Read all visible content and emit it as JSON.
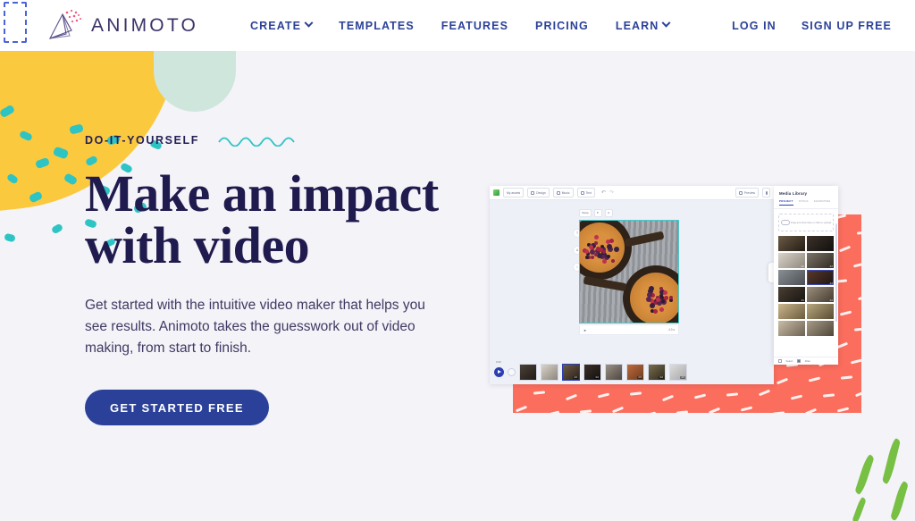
{
  "brand": {
    "name": "ANIMOTO",
    "logo_icon": "animoto-fan-logo",
    "accent_blue": "#2b4199",
    "headline_navy": "#201b4e",
    "teal": "#2ec4c4",
    "yellow": "#fbc93d",
    "coral": "#fb6d5d",
    "green": "#77c043"
  },
  "nav": {
    "items": [
      {
        "label": "CREATE",
        "has_dropdown": true
      },
      {
        "label": "TEMPLATES",
        "has_dropdown": false
      },
      {
        "label": "FEATURES",
        "has_dropdown": false
      },
      {
        "label": "PRICING",
        "has_dropdown": false
      },
      {
        "label": "LEARN",
        "has_dropdown": true
      }
    ],
    "login_label": "LOG IN",
    "signup_label": "SIGN UP FREE"
  },
  "hero": {
    "eyebrow": "DO-IT-YOURSELF",
    "headline_line1": "Make an impact",
    "headline_line2": "with video",
    "subcopy": "Get started with the intuitive video maker that helps you see results. Animoto takes the guesswork out of video making, from start to finish.",
    "cta_label": "GET STARTED FREE"
  },
  "app_mockup": {
    "toolbar": {
      "buttons": [
        {
          "label": "My assets",
          "icon": "grid-icon"
        },
        {
          "label": "Design",
          "icon": "pencil-icon"
        },
        {
          "label": "Music",
          "icon": "note-icon"
        },
        {
          "label": "Text",
          "icon": "text-icon"
        }
      ],
      "undo_icon": "undo-icon",
      "redo_icon": "redo-icon",
      "preview_label": "Preview",
      "preview_icon": "expand-icon",
      "share_icon": "share-icon"
    },
    "frame_tools": [
      {
        "label": "Swap"
      },
      {
        "label": "",
        "icon": "rotate-icon"
      },
      {
        "label": "",
        "icon": "trash-icon"
      }
    ],
    "side_handles": [
      "T",
      "A",
      "I"
    ],
    "photo_footer": {
      "duration": "4.0 s",
      "left_icon": "play-icon"
    },
    "timeline": {
      "time_label": "0:20",
      "play_icon": "play-icon",
      "add_icon": "plus-icon",
      "clips": [
        {
          "badge": ""
        },
        {
          "badge": ""
        },
        {
          "badge": "4.0",
          "selected": true
        },
        {
          "badge": "3.0"
        },
        {
          "badge": ""
        },
        {
          "badge": "2.5"
        },
        {
          "badge": "3.0"
        },
        {
          "badge": "4.0"
        }
      ]
    },
    "media_library": {
      "title": "Media Library",
      "tabs": [
        {
          "label": "PROJECT",
          "active": true
        },
        {
          "label": "STOCK",
          "active": false
        },
        {
          "label": "FAVORITES",
          "active": false
        }
      ],
      "dropzone_text": "Drag and drop files or click to upload",
      "dropzone_icon": "cloud-upload-icon",
      "thumbnails": [
        {
          "dur": "",
          "selected": false
        },
        {
          "dur": "",
          "selected": false
        },
        {
          "dur": "3.0",
          "selected": false
        },
        {
          "dur": "4.0",
          "selected": false
        },
        {
          "dur": "",
          "selected": false
        },
        {
          "dur": "4.0",
          "selected": true
        },
        {
          "dur": "3.0",
          "selected": false
        },
        {
          "dur": "2.0",
          "selected": false
        },
        {
          "dur": "",
          "selected": false
        },
        {
          "dur": "",
          "selected": false
        },
        {
          "dur": "",
          "selected": false
        },
        {
          "dur": "",
          "selected": false
        }
      ],
      "footer": {
        "select_label": "Select",
        "filter_label": "Filter",
        "more_icon": "more-icon"
      }
    }
  }
}
